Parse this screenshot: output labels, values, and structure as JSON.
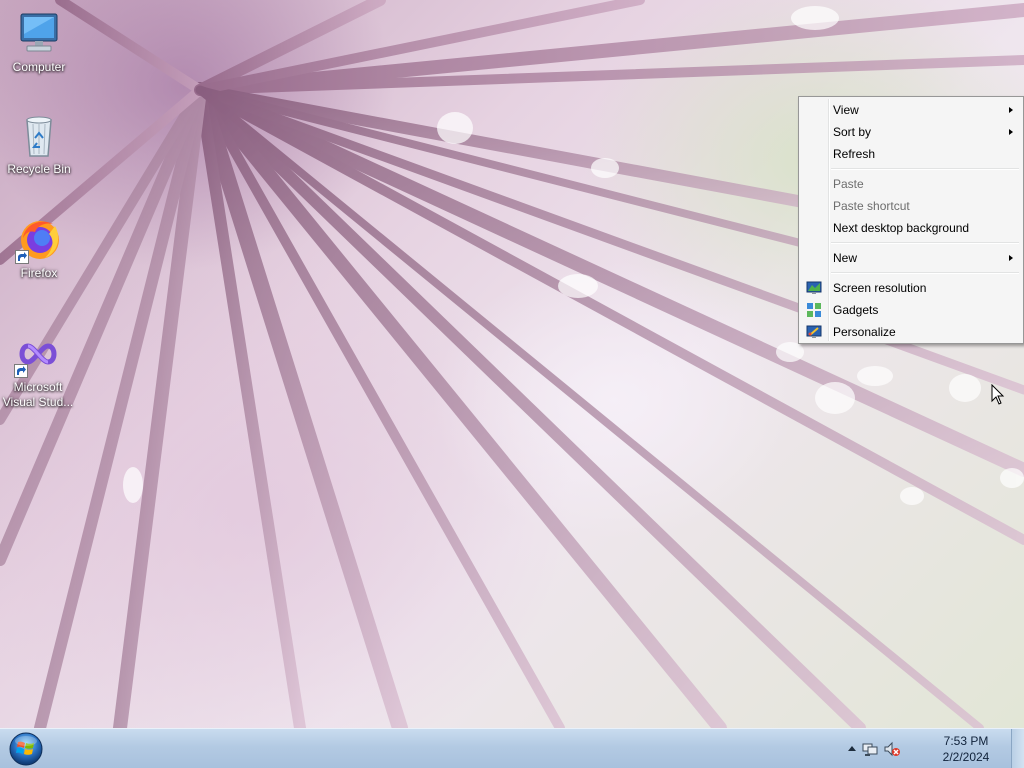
{
  "desktop": {
    "icons": [
      {
        "label": "Computer",
        "icon": "computer-icon"
      },
      {
        "label": "Recycle Bin",
        "icon": "recycle-bin-icon"
      },
      {
        "label": "Firefox",
        "icon": "firefox-icon"
      },
      {
        "label": "Microsoft Visual Stud...",
        "icon": "visual-studio-icon"
      }
    ]
  },
  "context_menu": {
    "items": [
      {
        "label": "View",
        "has_submenu": true,
        "enabled": true
      },
      {
        "label": "Sort by",
        "has_submenu": true,
        "enabled": true
      },
      {
        "label": "Refresh",
        "has_submenu": false,
        "enabled": true
      },
      {
        "label": "Paste",
        "has_submenu": false,
        "enabled": false
      },
      {
        "label": "Paste shortcut",
        "has_submenu": false,
        "enabled": false
      },
      {
        "label": "Next desktop background",
        "has_submenu": false,
        "enabled": true
      },
      {
        "label": "New",
        "has_submenu": true,
        "enabled": true
      },
      {
        "label": "Screen resolution",
        "icon": "display-icon",
        "enabled": true
      },
      {
        "label": "Gadgets",
        "icon": "gadgets-icon",
        "enabled": true
      },
      {
        "label": "Personalize",
        "icon": "personalize-icon",
        "enabled": true
      }
    ]
  },
  "taskbar": {
    "start_icon": "windows-start-orb-icon",
    "tray": {
      "icons": [
        "show-hidden-icons-chevron-icon",
        "network-icon",
        "volume-muted-icon"
      ],
      "time": "7:53 PM",
      "date": "2/2/2024"
    }
  },
  "colors": {
    "taskbar": "#b3cae3",
    "menu_background": "#f5f5f5",
    "menu_disabled_text": "#6d6d6d"
  }
}
